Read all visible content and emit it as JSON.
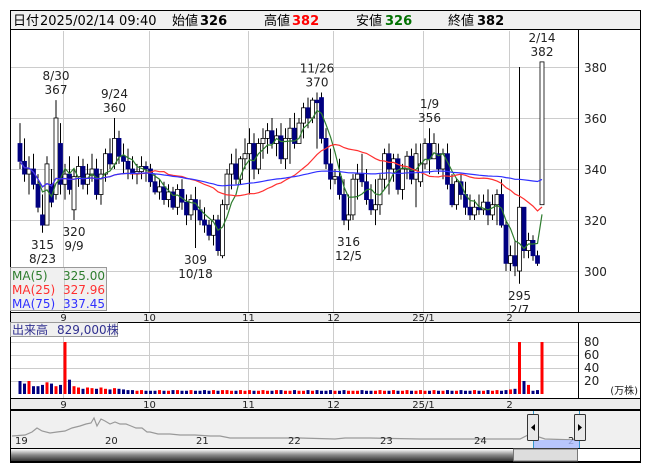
{
  "header": {
    "date_label": "日付",
    "datetime": "2025/02/14 09:40",
    "open_label": "始値",
    "open": "326",
    "high_label": "高値",
    "high": "382",
    "low_label": "安値",
    "low": "326",
    "close_label": "終値",
    "close": "382"
  },
  "legend": [
    {
      "label": "MA(5)",
      "value": "325.00",
      "color": "#2e7d2e"
    },
    {
      "label": "MA(25)",
      "value": "327.96",
      "color": "#ff3030"
    },
    {
      "label": "MA(75)",
      "value": "337.45",
      "color": "#3030ff"
    }
  ],
  "volume_header": {
    "label": "出来高",
    "value": "829,000株"
  },
  "volume_unit": "(万株)",
  "navigator": {
    "year_labels": [
      "19",
      "20",
      "21",
      "22",
      "23",
      "24",
      "2"
    ]
  },
  "chart_data": {
    "type": "candlestick",
    "price_axis": {
      "ticks": [
        300,
        320,
        340,
        360,
        380
      ],
      "range": [
        284,
        392
      ]
    },
    "volume_axis": {
      "ticks": [
        20,
        40,
        60,
        80
      ],
      "unit": "万株"
    },
    "month_ticks": [
      {
        "label": "9",
        "idx": 10
      },
      {
        "label": "10",
        "idx": 29
      },
      {
        "label": "11",
        "idx": 51
      },
      {
        "label": "12",
        "idx": 70
      },
      {
        "label": "25/1",
        "idx": 90
      },
      {
        "label": "2",
        "idx": 109
      }
    ],
    "colors": {
      "up": "#ffffff",
      "down": "#000080",
      "vol_up": "#ff0000",
      "vol_down": "#000080",
      "vol_flat": "#999999",
      "ma5": "#2e7d2e",
      "ma25": "#ff3030",
      "ma75": "#3030ff"
    },
    "ohlc": [
      [
        350,
        358,
        340,
        343
      ],
      [
        343,
        352,
        335,
        338
      ],
      [
        338,
        345,
        330,
        340
      ],
      [
        340,
        346,
        332,
        334
      ],
      [
        334,
        338,
        323,
        325
      ],
      [
        322,
        330,
        315,
        318
      ],
      [
        318,
        345,
        318,
        342
      ],
      [
        334,
        340,
        325,
        327
      ],
      [
        330,
        367,
        328,
        360
      ],
      [
        350,
        358,
        330,
        334
      ],
      [
        334,
        342,
        328,
        338
      ],
      [
        338,
        345,
        330,
        332
      ],
      [
        324,
        340,
        320,
        337
      ],
      [
        337,
        345,
        333,
        341
      ],
      [
        341,
        344,
        332,
        334
      ],
      [
        334,
        342,
        330,
        338
      ],
      [
        338,
        346,
        335,
        340
      ],
      [
        340,
        344,
        328,
        330
      ],
      [
        330,
        340,
        326,
        338
      ],
      [
        338,
        348,
        335,
        346
      ],
      [
        346,
        352,
        340,
        342
      ],
      [
        342,
        360,
        340,
        352
      ],
      [
        352,
        355,
        342,
        345
      ],
      [
        345,
        350,
        338,
        343
      ],
      [
        343,
        348,
        336,
        340
      ],
      [
        340,
        345,
        336,
        338
      ],
      [
        338,
        342,
        334,
        339
      ],
      [
        339,
        345,
        336,
        341
      ],
      [
        341,
        343,
        335,
        340
      ],
      [
        340,
        342,
        333,
        335
      ],
      [
        335,
        338,
        330,
        331
      ],
      [
        331,
        336,
        328,
        333
      ],
      [
        333,
        335,
        326,
        328
      ],
      [
        328,
        334,
        325,
        331
      ],
      [
        331,
        333,
        324,
        325
      ],
      [
        325,
        334,
        322,
        332
      ],
      [
        332,
        336,
        324,
        327
      ],
      [
        327,
        330,
        318,
        322
      ],
      [
        322,
        330,
        320,
        328
      ],
      [
        328,
        333,
        309,
        324
      ],
      [
        324,
        328,
        318,
        320
      ],
      [
        320,
        325,
        315,
        318
      ],
      [
        318,
        320,
        312,
        314
      ],
      [
        314,
        322,
        310,
        320
      ],
      [
        320,
        322,
        306,
        308
      ],
      [
        306,
        328,
        305,
        326
      ],
      [
        326,
        340,
        324,
        338
      ],
      [
        338,
        346,
        332,
        342
      ],
      [
        342,
        348,
        334,
        336
      ],
      [
        336,
        345,
        334,
        344
      ],
      [
        344,
        352,
        340,
        346
      ],
      [
        346,
        356,
        330,
        350
      ],
      [
        350,
        354,
        336,
        340
      ],
      [
        340,
        352,
        338,
        350
      ],
      [
        350,
        356,
        344,
        352
      ],
      [
        352,
        358,
        346,
        355
      ],
      [
        355,
        360,
        348,
        350
      ],
      [
        350,
        356,
        345,
        353
      ],
      [
        353,
        358,
        342,
        344
      ],
      [
        344,
        356,
        340,
        352
      ],
      [
        352,
        360,
        342,
        356
      ],
      [
        356,
        362,
        348,
        350
      ],
      [
        350,
        360,
        350,
        358
      ],
      [
        358,
        366,
        352,
        364
      ],
      [
        364,
        368,
        356,
        360
      ],
      [
        360,
        368,
        358,
        367
      ],
      [
        367,
        370,
        348,
        366
      ],
      [
        368,
        370,
        350,
        352
      ],
      [
        352,
        356,
        340,
        342
      ],
      [
        342,
        348,
        332,
        336
      ],
      [
        336,
        340,
        334,
        337
      ],
      [
        337,
        344,
        328,
        330
      ],
      [
        330,
        336,
        318,
        320
      ],
      [
        320,
        330,
        316,
        322
      ],
      [
        322,
        338,
        320,
        336
      ],
      [
        336,
        342,
        328,
        338
      ],
      [
        338,
        346,
        333,
        335
      ],
      [
        335,
        340,
        326,
        328
      ],
      [
        328,
        334,
        322,
        324
      ],
      [
        324,
        336,
        318,
        326
      ],
      [
        326,
        338,
        322,
        336
      ],
      [
        336,
        348,
        332,
        346
      ],
      [
        346,
        350,
        330,
        340
      ],
      [
        340,
        346,
        335,
        344
      ],
      [
        344,
        346,
        330,
        332
      ],
      [
        332,
        342,
        328,
        340
      ],
      [
        340,
        347,
        336,
        345
      ],
      [
        345,
        348,
        334,
        336
      ],
      [
        336,
        350,
        325,
        346
      ],
      [
        335,
        350,
        333,
        342
      ],
      [
        342,
        352,
        340,
        350
      ],
      [
        350,
        356,
        338,
        344
      ],
      [
        344,
        354,
        345,
        350
      ],
      [
        346,
        350,
        338,
        340
      ],
      [
        340,
        348,
        336,
        346
      ],
      [
        346,
        350,
        332,
        334
      ],
      [
        334,
        338,
        325,
        326
      ],
      [
        326,
        336,
        324,
        335
      ],
      [
        335,
        338,
        328,
        330
      ],
      [
        330,
        335,
        322,
        325
      ],
      [
        325,
        330,
        320,
        322
      ],
      [
        322,
        328,
        320,
        325
      ],
      [
        325,
        330,
        322,
        324
      ],
      [
        324,
        330,
        322,
        327
      ],
      [
        327,
        332,
        318,
        322
      ],
      [
        322,
        330,
        320,
        326
      ],
      [
        326,
        332,
        318,
        330
      ],
      [
        330,
        336,
        317,
        318
      ],
      [
        318,
        320,
        300,
        303
      ],
      [
        303,
        310,
        300,
        306
      ],
      [
        306,
        312,
        298,
        302
      ],
      [
        300,
        380,
        295,
        325
      ],
      [
        325,
        325,
        305,
        308
      ],
      [
        308,
        315,
        305,
        312
      ],
      [
        312,
        314,
        304,
        306
      ],
      [
        306,
        308,
        302,
        303
      ],
      [
        326,
        382,
        326,
        382
      ]
    ],
    "volume": [
      20,
      16,
      20,
      12,
      12,
      14,
      18,
      16,
      12,
      14,
      80,
      22,
      12,
      10,
      8,
      10,
      9,
      8,
      10,
      8,
      7,
      9,
      8,
      7,
      6,
      6,
      5,
      6,
      5,
      5,
      5,
      6,
      5,
      5,
      6,
      6,
      5,
      5,
      6,
      5,
      5,
      6,
      5,
      6,
      5,
      6,
      6,
      5,
      5,
      6,
      5,
      6,
      5,
      5,
      6,
      5,
      5,
      6,
      6,
      5,
      5,
      6,
      5,
      5,
      6,
      5,
      6,
      5,
      5,
      6,
      5,
      5,
      6,
      5,
      5,
      5,
      6,
      5,
      5,
      5,
      6,
      5,
      5,
      6,
      5,
      5,
      6,
      5,
      5,
      6,
      5,
      5,
      6,
      5,
      5,
      6,
      5,
      5,
      6,
      5,
      5,
      6,
      5,
      5,
      6,
      5,
      6,
      5,
      6,
      7,
      8,
      80,
      20,
      14,
      5,
      6,
      80
    ],
    "annotations": [
      {
        "date": "8/23",
        "price": 315,
        "idx": 5,
        "side": "below"
      },
      {
        "date": "8/30",
        "price": 367,
        "idx": 8,
        "side": "above"
      },
      {
        "date": "9/9",
        "price": 320,
        "idx": 12,
        "side": "below"
      },
      {
        "date": "9/24",
        "price": 360,
        "idx": 21,
        "side": "above"
      },
      {
        "date": "10/18",
        "price": 309,
        "idx": 39,
        "side": "below"
      },
      {
        "date": "11/26",
        "price": 370,
        "idx": 66,
        "side": "above"
      },
      {
        "date": "12/5",
        "price": 316,
        "idx": 73,
        "side": "below"
      },
      {
        "date": "1/9",
        "price": 356,
        "idx": 91,
        "side": "above"
      },
      {
        "date": "2/7",
        "price": 295,
        "idx": 111,
        "side": "below"
      },
      {
        "date": "2/14",
        "price": 382,
        "idx": 116,
        "side": "above"
      }
    ]
  }
}
